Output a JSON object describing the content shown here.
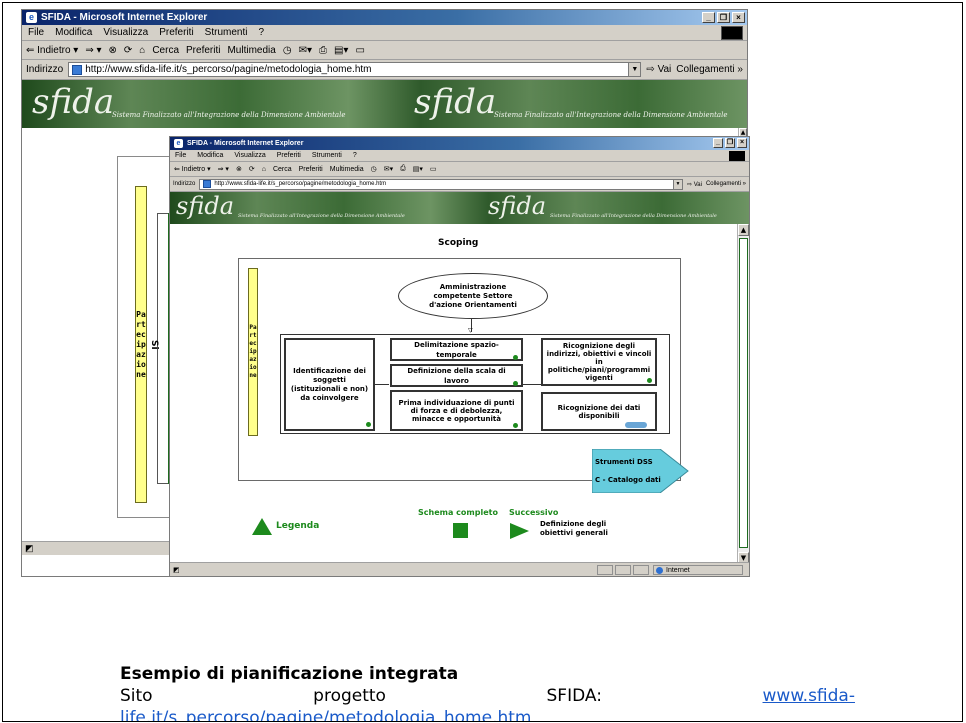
{
  "back_window": {
    "title": "SFIDA - Microsoft Internet Explorer",
    "menu": [
      "File",
      "Modifica",
      "Visualizza",
      "Preferiti",
      "Strumenti",
      "?"
    ],
    "toolbar": [
      "⇐ Indietro ▾",
      "⇒ ▾",
      "⊗",
      "⟳",
      "⌂",
      "Cerca",
      "Preferiti",
      "Multimedia",
      "◷",
      "✉▾",
      "⎙",
      "▤▾",
      "▭"
    ],
    "address_label": "Indirizzo",
    "address_value": "http://www.sfida-life.it/s_percorso/pagine/metodologia_home.htm",
    "go_label": "Vai",
    "links_label": "Collegamenti »",
    "banner_logo": "sfida",
    "banner_tagline": "Sistema Finalizzato all'Integrazione della Dimensione Ambientale",
    "side_bar_letters": "Partecipazione",
    "side_text": "Si"
  },
  "front_window": {
    "title": "SFIDA - Microsoft Internet Explorer",
    "menu": [
      "File",
      "Modifica",
      "Visualizza",
      "Preferiti",
      "Strumenti",
      "?"
    ],
    "toolbar": [
      "⇐ Indietro ▾",
      "⇒ ▾",
      "⊗",
      "⟳",
      "⌂",
      "Cerca",
      "Preferiti",
      "Multimedia",
      "◷",
      "✉▾",
      "⎙",
      "▤▾",
      "▭"
    ],
    "address_label": "Indirizzo",
    "address_value": "http://www.sfida-life.it/s_percorso/pagine/metodologia_home.htm",
    "go_label": "Vai",
    "links_label": "Collegamenti »",
    "banner_logo": "sfida",
    "banner_tagline": "Sistema Finalizzato all'Integrazione della Dimensione Ambientale",
    "status_text": "Internet"
  },
  "diagram": {
    "heading": "Scoping",
    "side_bar_letters": "Partecipazione",
    "ellipse_text": "Amministrazione competente Settore d'azione Orientamenti",
    "left_box": "Identificazione dei soggetti (istituzionali e non) da coinvolgere",
    "middle_boxes": [
      "Delimitazione spazio-temporale",
      "Definizione della scala di lavoro",
      "Prima individuazione di punti di forza e di debolezza, minacce e opportunità"
    ],
    "right_boxes": [
      "Ricognizione degli indirizzi, obiettivi e vincoli in politiche/piani/programmi vigenti",
      "Ricognizione dei dati disponibili"
    ],
    "tools_title": "Strumenti DSS",
    "tools_item": "C - Catalogo dati",
    "legend_label": "Legenda",
    "schema_label": "Schema completo",
    "next_label": "Successivo",
    "next_text": "Definizione degli obiettivi generali"
  },
  "caption": {
    "title": "Esempio di pianificazione integrata",
    "words": [
      "Sito",
      "progetto",
      "SFIDA:"
    ],
    "link_part1": "www.sfida-",
    "link_part2": "life.it/s_percorso/pagine/metodologia_home.htm"
  },
  "colors": {
    "titlebar": "#0a246a",
    "yellow_bar": "#ffff8c",
    "green": "#1d8a1d",
    "cyan_arrow": "#66ccdd",
    "link": "#1a5ac9"
  }
}
